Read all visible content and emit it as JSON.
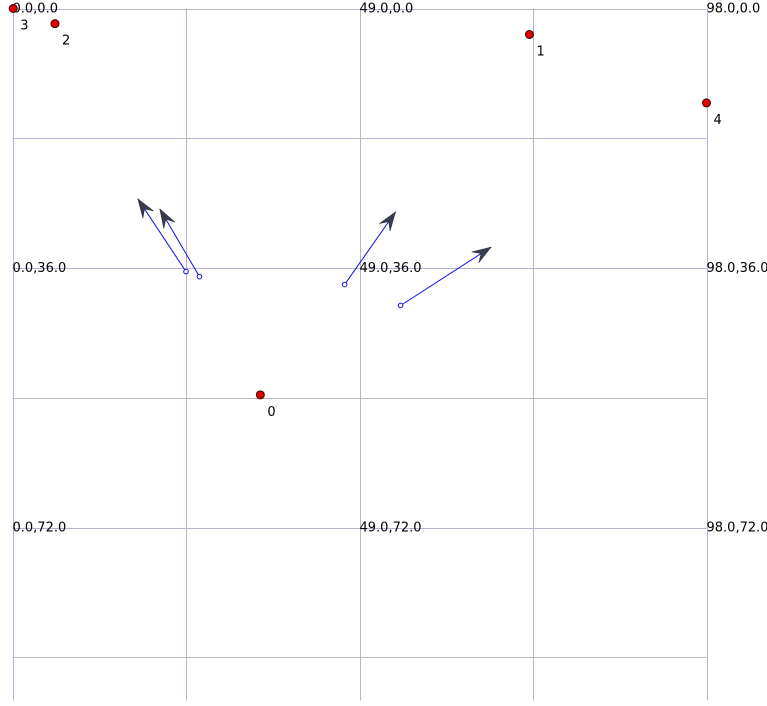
{
  "grid": {
    "x_range": [
      0,
      98
    ],
    "y_range": [
      0,
      72
    ],
    "x_ticks": [
      0,
      24.5,
      49,
      73.5,
      98
    ],
    "y_ticks": [
      0,
      18,
      36,
      54,
      72,
      90
    ],
    "line_color": "#b4b4d2"
  },
  "coord_labels": [
    {
      "text": "0.0,0.0",
      "x": 0,
      "y": 0
    },
    {
      "text": "49.0,0.0",
      "x": 49,
      "y": 0
    },
    {
      "text": "98.0,0.0",
      "x": 98,
      "y": 0
    },
    {
      "text": "0.0,36.0",
      "x": 0,
      "y": 36
    },
    {
      "text": "49.0,36.0",
      "x": 49,
      "y": 36
    },
    {
      "text": "98.0,36.0",
      "x": 98,
      "y": 36
    },
    {
      "text": "0.0,72.0",
      "x": 0,
      "y": 72
    },
    {
      "text": "49.0,72.0",
      "x": 49,
      "y": 72
    },
    {
      "text": "98.0,72.0",
      "x": 98,
      "y": 72
    }
  ],
  "points": [
    {
      "label": "0",
      "x": 35.0,
      "y": 53.6
    },
    {
      "label": "1",
      "x": 73.0,
      "y": 3.6
    },
    {
      "label": "2",
      "x": 6.0,
      "y": 2.1
    },
    {
      "label": "3",
      "x": 0.1,
      "y": 0.0
    },
    {
      "label": "4",
      "x": 98.0,
      "y": 13.1
    }
  ],
  "point_color": "#e00000",
  "vectors": [
    {
      "x1": 24.5,
      "y1": 36.5,
      "x2": 17.7,
      "y2": 26.4
    },
    {
      "x1": 26.4,
      "y1": 37.2,
      "x2": 20.8,
      "y2": 27.8
    },
    {
      "x1": 46.9,
      "y1": 38.3,
      "x2": 54.1,
      "y2": 28.2
    },
    {
      "x1": 54.8,
      "y1": 41.2,
      "x2": 67.6,
      "y2": 33.1
    }
  ],
  "vector_color": "#1010e0",
  "arrowhead_color": "#3a3d4d"
}
